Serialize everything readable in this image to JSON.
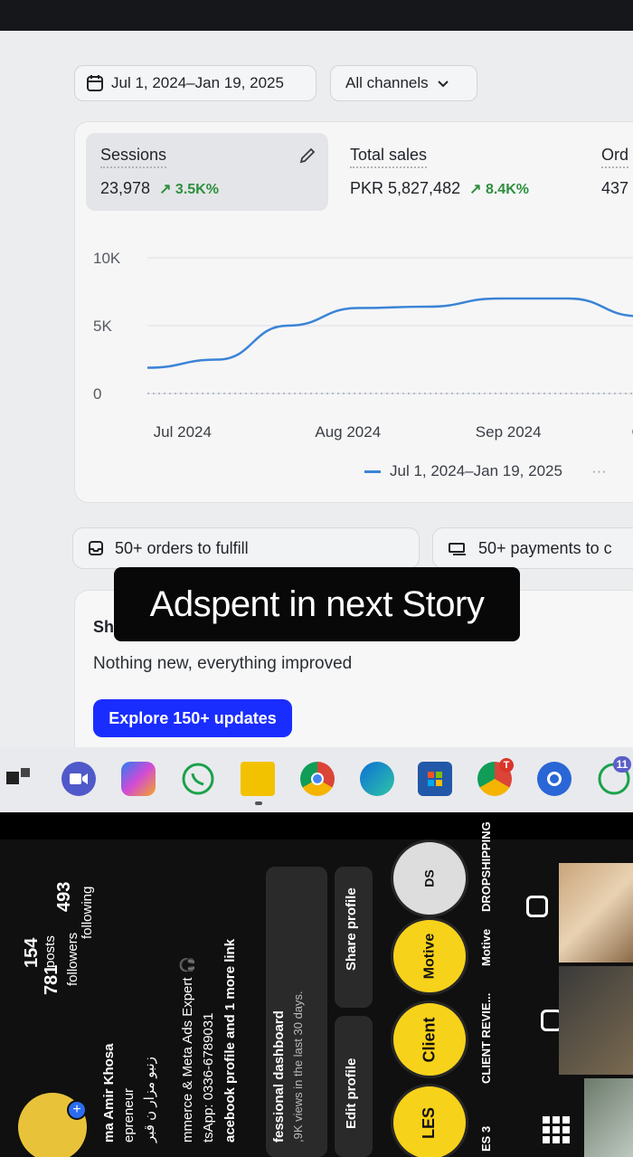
{
  "toolbar": {
    "date_range": "Jul 1, 2024–Jan 19, 2025",
    "channels": "All channels"
  },
  "metrics": [
    {
      "label": "Sessions",
      "value": "23,978",
      "change": "3.5K%"
    },
    {
      "label": "Total sales",
      "value": "PKR 5,827,482",
      "change": "8.4K%"
    },
    {
      "label": "Ord",
      "value": "437"
    }
  ],
  "chart_data": {
    "type": "line",
    "title": "",
    "xlabel": "",
    "ylabel": "",
    "ylim": [
      0,
      10000
    ],
    "y_ticks": [
      "10K",
      "5K",
      "0"
    ],
    "x_ticks": [
      "Jul 2024",
      "Aug 2024",
      "Sep 2024",
      "Oct"
    ],
    "series": [
      {
        "name": "Jul 1, 2024–Jan 19, 2025",
        "color": "#3b84d6",
        "points": [
          {
            "x": "2024-07-01",
            "y": 1900
          },
          {
            "x": "2024-07-15",
            "y": 2500
          },
          {
            "x": "2024-07-29",
            "y": 5000
          },
          {
            "x": "2024-08-12",
            "y": 6300
          },
          {
            "x": "2024-08-26",
            "y": 6400
          },
          {
            "x": "2024-09-09",
            "y": 7000
          },
          {
            "x": "2024-09-23",
            "y": 7000
          },
          {
            "x": "2024-10-07",
            "y": 5700
          }
        ]
      },
      {
        "name": "",
        "color": "#b7bcc4",
        "style": "dotted",
        "values": [
          0,
          0,
          0,
          0,
          0,
          0,
          0,
          0
        ]
      }
    ],
    "legend": "bottom"
  },
  "pills": {
    "orders": "50+ orders to fulfill",
    "payments": "50+ payments to c"
  },
  "updates": {
    "title": "Sh",
    "subtitle": "Nothing new, everything improved",
    "button": "Explore 150+ updates"
  },
  "story_text": "Adspent in next Story",
  "taskbar": {
    "apps": [
      "start-icon",
      "teams-icon",
      "copilot-icon",
      "whatsapp-icon",
      "file-explorer-icon",
      "chrome-icon",
      "edge-icon",
      "store-icon",
      "chrome-profile-icon",
      "chrome-remote-icon",
      "whatsapp-business-icon"
    ],
    "badge": "11",
    "profile_badge": "T"
  },
  "instagram": {
    "stats": [
      {
        "num": "154",
        "label": "posts"
      },
      {
        "num": "781",
        "label": "followers"
      },
      {
        "num": "493",
        "label": "following"
      }
    ],
    "bio": [
      "ma Amir Khosa",
      "epreneur",
      "زنبو مزار ن قبر",
      "mmerce & Meta Ads Expert 🎧",
      "tsApp: 0336-6789031",
      "acebook profile and 1 more link"
    ],
    "dashboard_title": "fessional dashboard",
    "dashboard_sub": ",9K views in the last 30 days.",
    "edit_profile": "Edit profile",
    "share_profile": "Share profile",
    "highlights": [
      {
        "label": "ES 3",
        "badge": "LES"
      },
      {
        "label": "CLIENT REVIE...",
        "badge": "Client"
      },
      {
        "label": "Motive",
        "badge": "Motive"
      },
      {
        "label": "DROPSHIPPING",
        "badge": "DS"
      }
    ]
  }
}
